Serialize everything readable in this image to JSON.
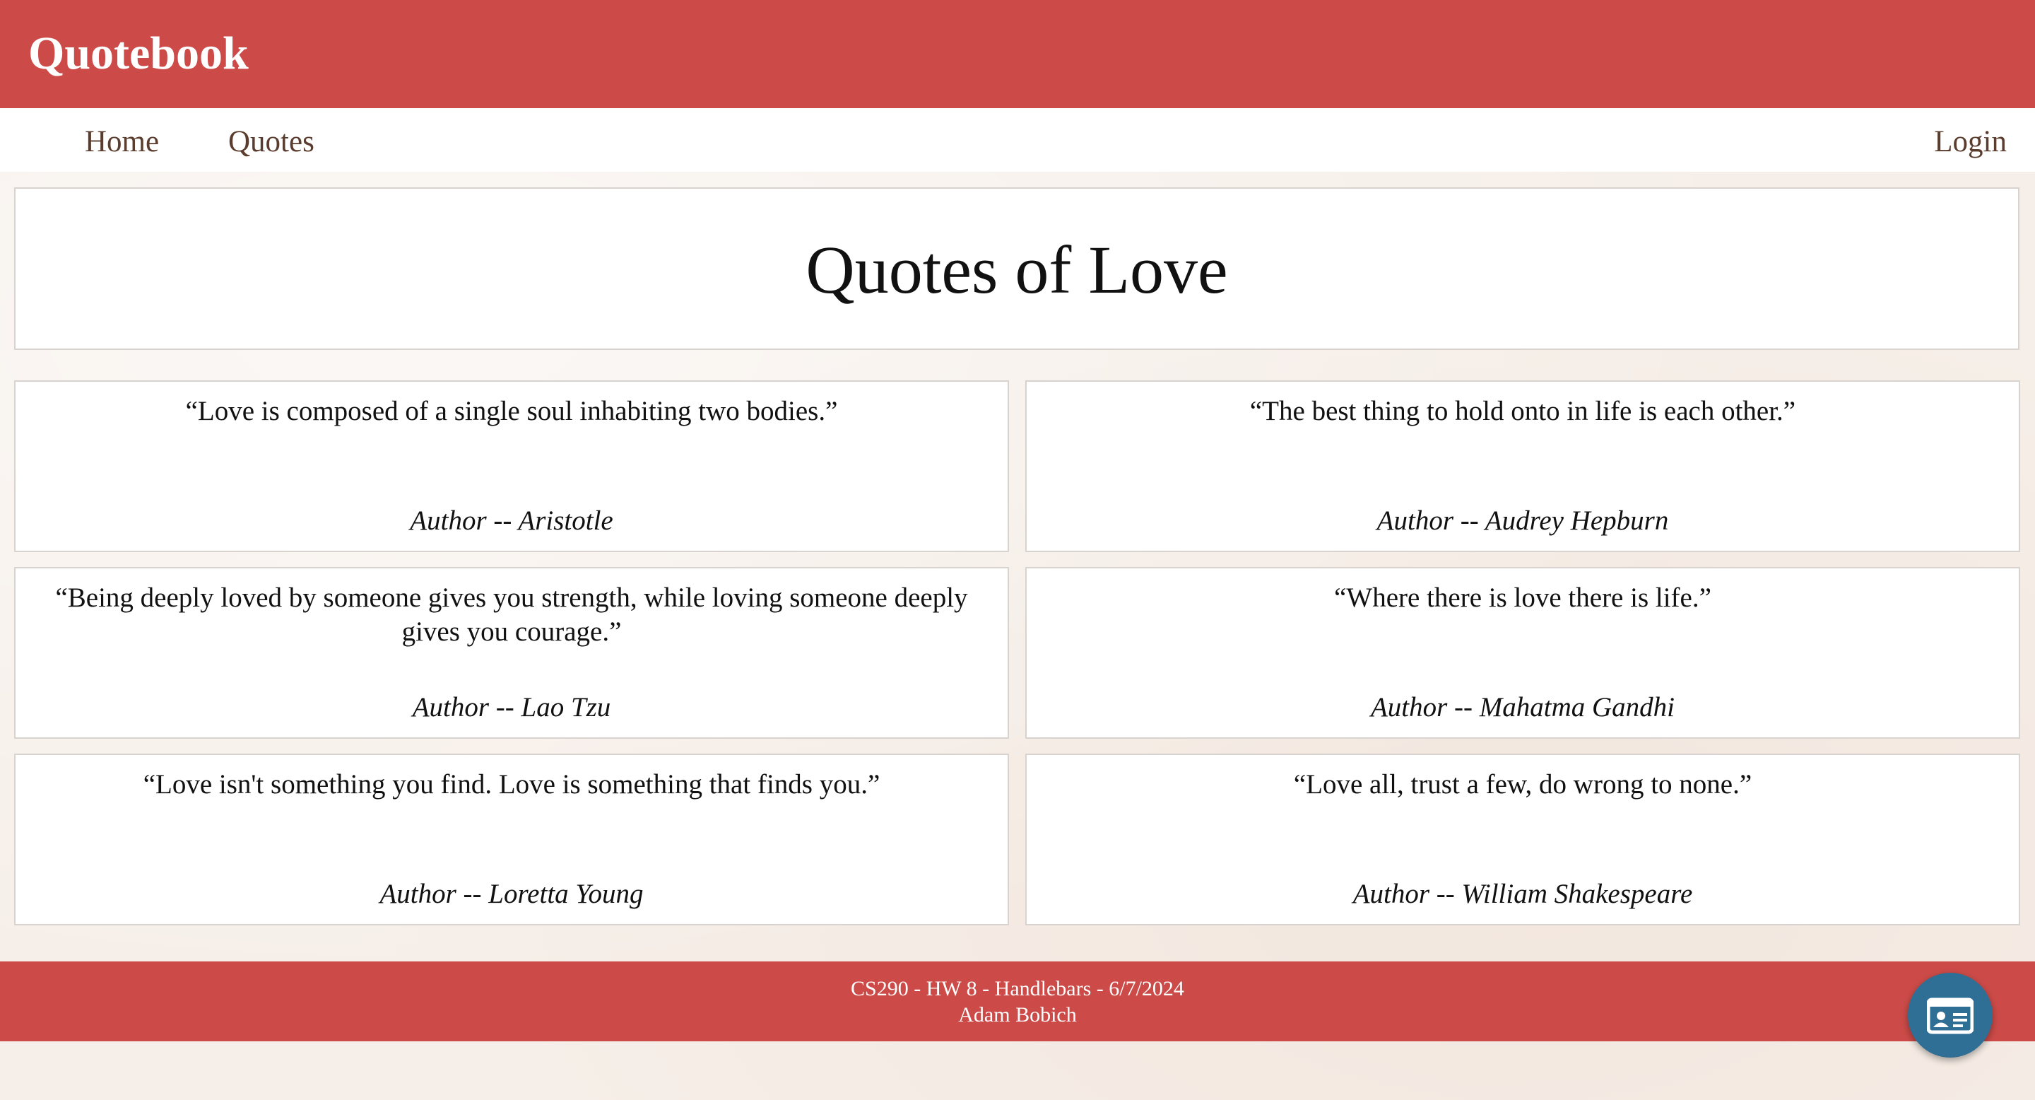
{
  "header": {
    "brand": "Quotebook"
  },
  "nav": {
    "home": "Home",
    "quotes": "Quotes",
    "login": "Login"
  },
  "main": {
    "title": "Quotes of Love",
    "quotes": [
      {
        "text": "“Love is composed of a single soul inhabiting two bodies.”",
        "author": "Author -- Aristotle"
      },
      {
        "text": "“The best thing to hold onto in life is each other.”",
        "author": "Author -- Audrey Hepburn"
      },
      {
        "text": "“Being deeply loved by someone gives you strength, while loving someone deeply gives you courage.”",
        "author": "Author -- Lao Tzu"
      },
      {
        "text": "“Where there is love there is life.”",
        "author": "Author -- Mahatma Gandhi"
      },
      {
        "text": "“Love isn't something you find. Love is something that finds you.”",
        "author": "Author -- Loretta Young"
      },
      {
        "text": "“Love all, trust a few, do wrong to none.”",
        "author": "Author -- William Shakespeare"
      }
    ]
  },
  "footer": {
    "line1": "CS290 - HW 8 - Handlebars - 6/7/2024",
    "line2": "Adam Bobich"
  },
  "fab": {
    "icon": "id-card-icon"
  },
  "colors": {
    "brand_red": "#cc4b48",
    "nav_text": "#5a3d2e",
    "fab_blue": "#2f6f95"
  }
}
